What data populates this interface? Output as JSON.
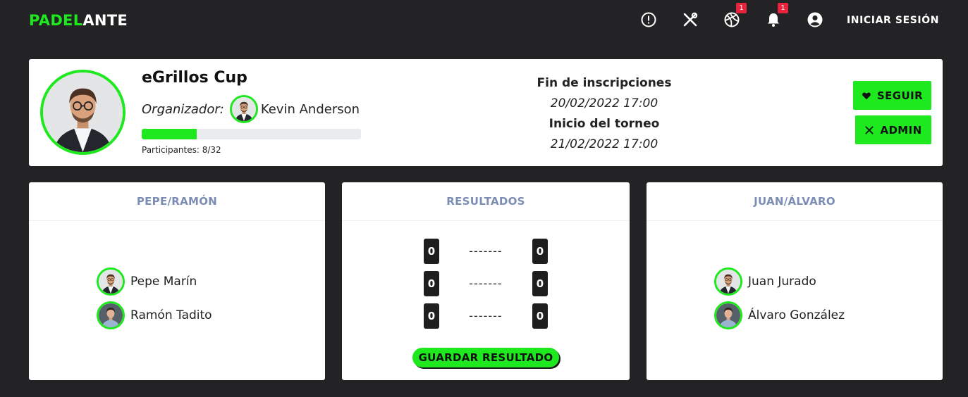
{
  "brand": {
    "part1": "PADEL",
    "part2": "ANTE",
    "accent": "#1ee81e"
  },
  "nav": {
    "icons": [
      {
        "name": "alert-icon"
      },
      {
        "name": "tools-icon"
      },
      {
        "name": "ball-icon",
        "badge": "1"
      },
      {
        "name": "bell-icon",
        "badge": "1"
      },
      {
        "name": "account-icon"
      }
    ],
    "login": "INICIAR SESIÓN"
  },
  "tournament": {
    "name": "eGrillos Cup",
    "organizer_label": "Organizador:",
    "organizer_name": "Kevin Anderson",
    "progress_fraction": 0.25,
    "participants": "Participantes: 8/32",
    "registration_end_label": "Fin de inscripciones",
    "registration_end": "20/02/2022 17:00",
    "start_label": "Inicio del torneo",
    "start": "21/02/2022 17:00",
    "follow_button": "SEGUIR",
    "admin_button": "ADMIN"
  },
  "team_left": {
    "title": "PEPE/RAMÓN",
    "players": [
      "Pepe Marín",
      "Ramón Tadito"
    ]
  },
  "results": {
    "title": "RESULTADOS",
    "sets": [
      {
        "left": "0",
        "sep": "-------",
        "right": "0"
      },
      {
        "left": "0",
        "sep": "-------",
        "right": "0"
      },
      {
        "left": "0",
        "sep": "-------",
        "right": "0"
      }
    ],
    "save_button": "GUARDAR RESULTADO"
  },
  "team_right": {
    "title": "JUAN/ÁLVARO",
    "players": [
      "Juan Jurado",
      "Álvaro González"
    ]
  }
}
